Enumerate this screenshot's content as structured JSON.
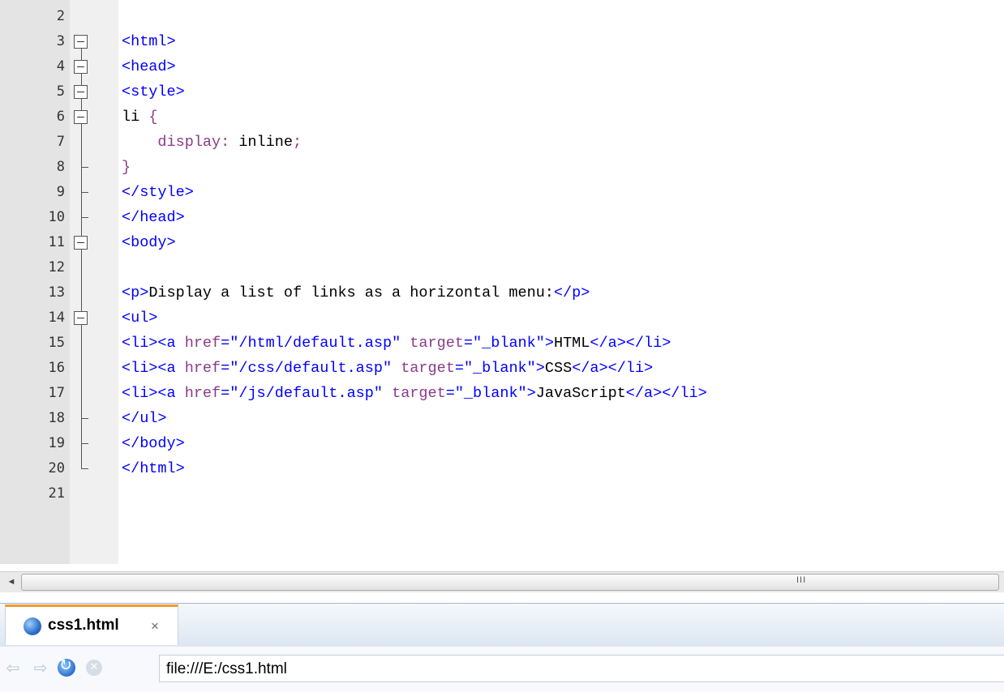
{
  "editor": {
    "lines": [
      {
        "num": "2",
        "segments": []
      },
      {
        "num": "3",
        "segments": [
          {
            "c": "tag",
            "t": "<html>"
          }
        ]
      },
      {
        "num": "4",
        "segments": [
          {
            "c": "tag",
            "t": "<head>"
          }
        ]
      },
      {
        "num": "5",
        "segments": [
          {
            "c": "tag",
            "t": "<style>"
          }
        ]
      },
      {
        "num": "6",
        "segments": [
          {
            "c": "sel",
            "t": "li "
          },
          {
            "c": "brace",
            "t": "{"
          }
        ]
      },
      {
        "num": "7",
        "segments": [
          {
            "c": "prop",
            "t": "    display: "
          },
          {
            "c": "val",
            "t": "inline"
          },
          {
            "c": "prop",
            "t": ";"
          }
        ]
      },
      {
        "num": "8",
        "segments": [
          {
            "c": "brace",
            "t": "}"
          }
        ]
      },
      {
        "num": "9",
        "segments": [
          {
            "c": "tag",
            "t": "</style>"
          }
        ]
      },
      {
        "num": "10",
        "segments": [
          {
            "c": "tag",
            "t": "</head>"
          }
        ]
      },
      {
        "num": "11",
        "segments": [
          {
            "c": "tag",
            "t": "<body>"
          }
        ]
      },
      {
        "num": "12",
        "segments": []
      },
      {
        "num": "13",
        "segments": [
          {
            "c": "tag",
            "t": "<p>"
          },
          {
            "c": "txt",
            "t": "Display a list of links as a horizontal menu:"
          },
          {
            "c": "tag",
            "t": "</p>"
          }
        ]
      },
      {
        "num": "14",
        "segments": [
          {
            "c": "tag",
            "t": "<ul>"
          }
        ]
      },
      {
        "num": "15",
        "segments": [
          {
            "c": "tag",
            "t": "<li><a "
          },
          {
            "c": "attr",
            "t": "href"
          },
          {
            "c": "tag",
            "t": "="
          },
          {
            "c": "str",
            "t": "\"/html/default.asp\""
          },
          {
            "c": "tag",
            "t": " "
          },
          {
            "c": "attr",
            "t": "target"
          },
          {
            "c": "tag",
            "t": "="
          },
          {
            "c": "str",
            "t": "\"_blank\""
          },
          {
            "c": "tag",
            "t": ">"
          },
          {
            "c": "txt",
            "t": "HTML"
          },
          {
            "c": "tag",
            "t": "</a></li>"
          }
        ]
      },
      {
        "num": "16",
        "segments": [
          {
            "c": "tag",
            "t": "<li><a "
          },
          {
            "c": "attr",
            "t": "href"
          },
          {
            "c": "tag",
            "t": "="
          },
          {
            "c": "str",
            "t": "\"/css/default.asp\""
          },
          {
            "c": "tag",
            "t": " "
          },
          {
            "c": "attr",
            "t": "target"
          },
          {
            "c": "tag",
            "t": "="
          },
          {
            "c": "str",
            "t": "\"_blank\""
          },
          {
            "c": "tag",
            "t": ">"
          },
          {
            "c": "txt",
            "t": "CSS"
          },
          {
            "c": "tag",
            "t": "</a></li>"
          }
        ]
      },
      {
        "num": "17",
        "segments": [
          {
            "c": "tag",
            "t": "<li><a "
          },
          {
            "c": "attr",
            "t": "href"
          },
          {
            "c": "tag",
            "t": "="
          },
          {
            "c": "str",
            "t": "\"/js/default.asp\""
          },
          {
            "c": "tag",
            "t": " "
          },
          {
            "c": "attr",
            "t": "target"
          },
          {
            "c": "tag",
            "t": "="
          },
          {
            "c": "str",
            "t": "\"_blank\""
          },
          {
            "c": "tag",
            "t": ">"
          },
          {
            "c": "txt",
            "t": "JavaScript"
          },
          {
            "c": "tag",
            "t": "</a></li>"
          }
        ]
      },
      {
        "num": "18",
        "segments": [
          {
            "c": "tag",
            "t": "</ul>"
          }
        ]
      },
      {
        "num": "19",
        "segments": [
          {
            "c": "tag",
            "t": "</body>"
          }
        ]
      },
      {
        "num": "20",
        "segments": [
          {
            "c": "tag",
            "t": "</html>"
          }
        ]
      },
      {
        "num": "21",
        "segments": []
      }
    ],
    "folds": [
      {
        "line_index": 1,
        "type": "box"
      },
      {
        "line_index": 2,
        "type": "box"
      },
      {
        "line_index": 3,
        "type": "box"
      },
      {
        "line_index": 4,
        "type": "box"
      },
      {
        "line_index": 6,
        "type": "tick"
      },
      {
        "line_index": 7,
        "type": "tick"
      },
      {
        "line_index": 8,
        "type": "tick"
      },
      {
        "line_index": 9,
        "type": "box"
      },
      {
        "line_index": 12,
        "type": "box"
      },
      {
        "line_index": 16,
        "type": "tick"
      },
      {
        "line_index": 17,
        "type": "tick"
      },
      {
        "line_index": 18,
        "type": "end"
      }
    ],
    "scrollbar": {
      "left_arrow": "◄",
      "grip": "III"
    }
  },
  "browser": {
    "tab": {
      "label": "css1.html",
      "close": "×"
    },
    "nav": {
      "back": "⇦",
      "forward": "⇨",
      "stop": "✕"
    },
    "url": "file:///E:/css1.html"
  },
  "colors": {
    "tag": "#0000ff",
    "attr_prop": "#8b3a8b",
    "tab_accent": "#f29a2e"
  }
}
